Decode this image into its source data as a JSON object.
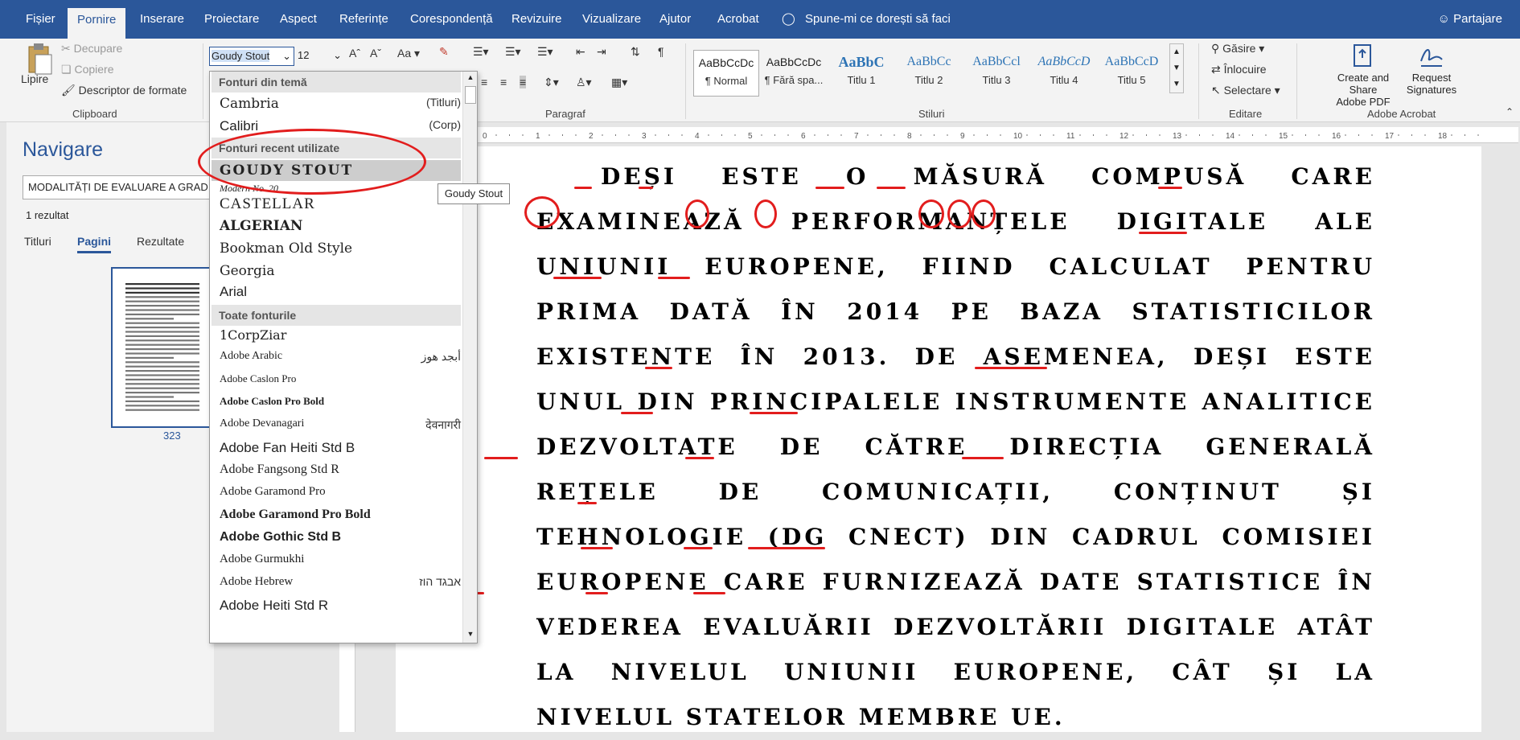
{
  "tabs": {
    "fisier": "Fișier",
    "pornire": "Pornire",
    "inserare": "Inserare",
    "proiectare": "Proiectare",
    "aspect": "Aspect",
    "referinte": "Referințe",
    "corespondenta": "Corespondență",
    "revizuire": "Revizuire",
    "vizualizare": "Vizualizare",
    "ajutor": "Ajutor",
    "acrobat": "Acrobat",
    "tell_me": "Spune-mi ce dorești să faci",
    "share": "Partajare"
  },
  "ribbon": {
    "clipboard": {
      "paste": "Lipire",
      "cut": "Decupare",
      "copy": "Copiere",
      "format_painter": "Descriptor de formate",
      "label": "Clipboard"
    },
    "font": {
      "name": "Goudy Stout",
      "size": "12",
      "case": "Aa"
    },
    "paragraph": {
      "label": "Paragraf"
    },
    "styles": {
      "label": "Stiluri",
      "items": [
        {
          "preview": "AaBbCcDc",
          "name": "¶ Normal"
        },
        {
          "preview": "AaBbCcDc",
          "name": "¶ Fără spa..."
        },
        {
          "preview": "AaBbC",
          "name": "Titlu 1"
        },
        {
          "preview": "AaBbCc",
          "name": "Titlu 2"
        },
        {
          "preview": "AaBbCcl",
          "name": "Titlu 3"
        },
        {
          "preview": "AaBbCcD",
          "name": "Titlu 4"
        },
        {
          "preview": "AaBbCcD",
          "name": "Titlu 5"
        }
      ]
    },
    "editing": {
      "label": "Editare",
      "find": "Găsire",
      "replace": "Înlocuire",
      "select": "Selectare"
    },
    "acrobat": {
      "label": "Adobe Acrobat",
      "create_line1": "Create and Share",
      "create_line2": "Adobe PDF",
      "request_line1": "Request",
      "request_line2": "Signatures"
    }
  },
  "navigation": {
    "title": "Navigare",
    "search_value": "MODALITĂȚI DE EVALUARE A GRAD",
    "results": "1 rezultat",
    "tabs": [
      "Titluri",
      "Pagini",
      "Rezultate"
    ],
    "page_number": "323"
  },
  "font_dropdown": {
    "theme_header": "Fonturi din temă",
    "recent_header": "Fonturi recent utilizate",
    "all_header": "Toate fonturile",
    "theme_fonts": [
      {
        "name": "Cambria",
        "tag": "(Titluri)"
      },
      {
        "name": "Calibri",
        "tag": "(Corp)"
      }
    ],
    "recent_fonts": [
      "GOUDY STOUT",
      "Modern No. 20",
      "CASTELLAR",
      "ALGERIAN",
      "Bookman Old Style",
      "Georgia",
      "Arial"
    ],
    "all_fonts": [
      {
        "name": "1CorpZiar",
        "tag": ""
      },
      {
        "name": "Adobe Arabic",
        "tag": "أبجد هوز"
      },
      {
        "name": "Adobe Caslon Pro",
        "tag": ""
      },
      {
        "name": "Adobe Caslon Pro Bold",
        "tag": ""
      },
      {
        "name": "Adobe Devanagari",
        "tag": "देवनागरी"
      },
      {
        "name": "Adobe Fan Heiti Std B",
        "tag": ""
      },
      {
        "name": "Adobe Fangsong Std R",
        "tag": ""
      },
      {
        "name": "Adobe Garamond Pro",
        "tag": ""
      },
      {
        "name": "Adobe Garamond Pro Bold",
        "tag": ""
      },
      {
        "name": "Adobe Gothic Std B",
        "tag": ""
      },
      {
        "name": "Adobe Gurmukhi",
        "tag": ""
      },
      {
        "name": "Adobe Hebrew",
        "tag": "אבגד הוז"
      },
      {
        "name": "Adobe Heiti Std R",
        "tag": ""
      }
    ],
    "tooltip": "Goudy Stout"
  },
  "document": {
    "paragraph": "DEȘI ESTE O MĂSURĂ COMPUSĂ CARE EXAMINEAZĂ PERFORMANȚELE DIGITALE ALE UNIUNII EUROPENE, FIIND CALCULAT PENTRU PRIMA DATĂ ÎN 2014 PE BAZA STATISTICILOR EXISTENTE ÎN 2013. DE ASEMENEA, DEȘI ESTE UNUL DIN PRINCIPALELE INSTRUMENTE ANALITICE DEZVOLTATE DE CĂTRE DIRECȚIA GENERALĂ REȚELE DE COMUNICAȚII, CONȚINUT ȘI TEHNOLOGIE (DG CNECT) DIN CADRUL COMISIEI EUROPENE CARE FURNIZEAZĂ DATE STATISTICE ÎN VEDEREA EVALUĂRII DEZVOLTĂRII DIGITALE ATÂT LA NIVELUL UNIUNII EUROPENE, CÂT ȘI LA NIVELUL STATELOR MEMBRE UE."
  },
  "colors": {
    "accent": "#2b579a",
    "annotation": "#e21d1d"
  }
}
